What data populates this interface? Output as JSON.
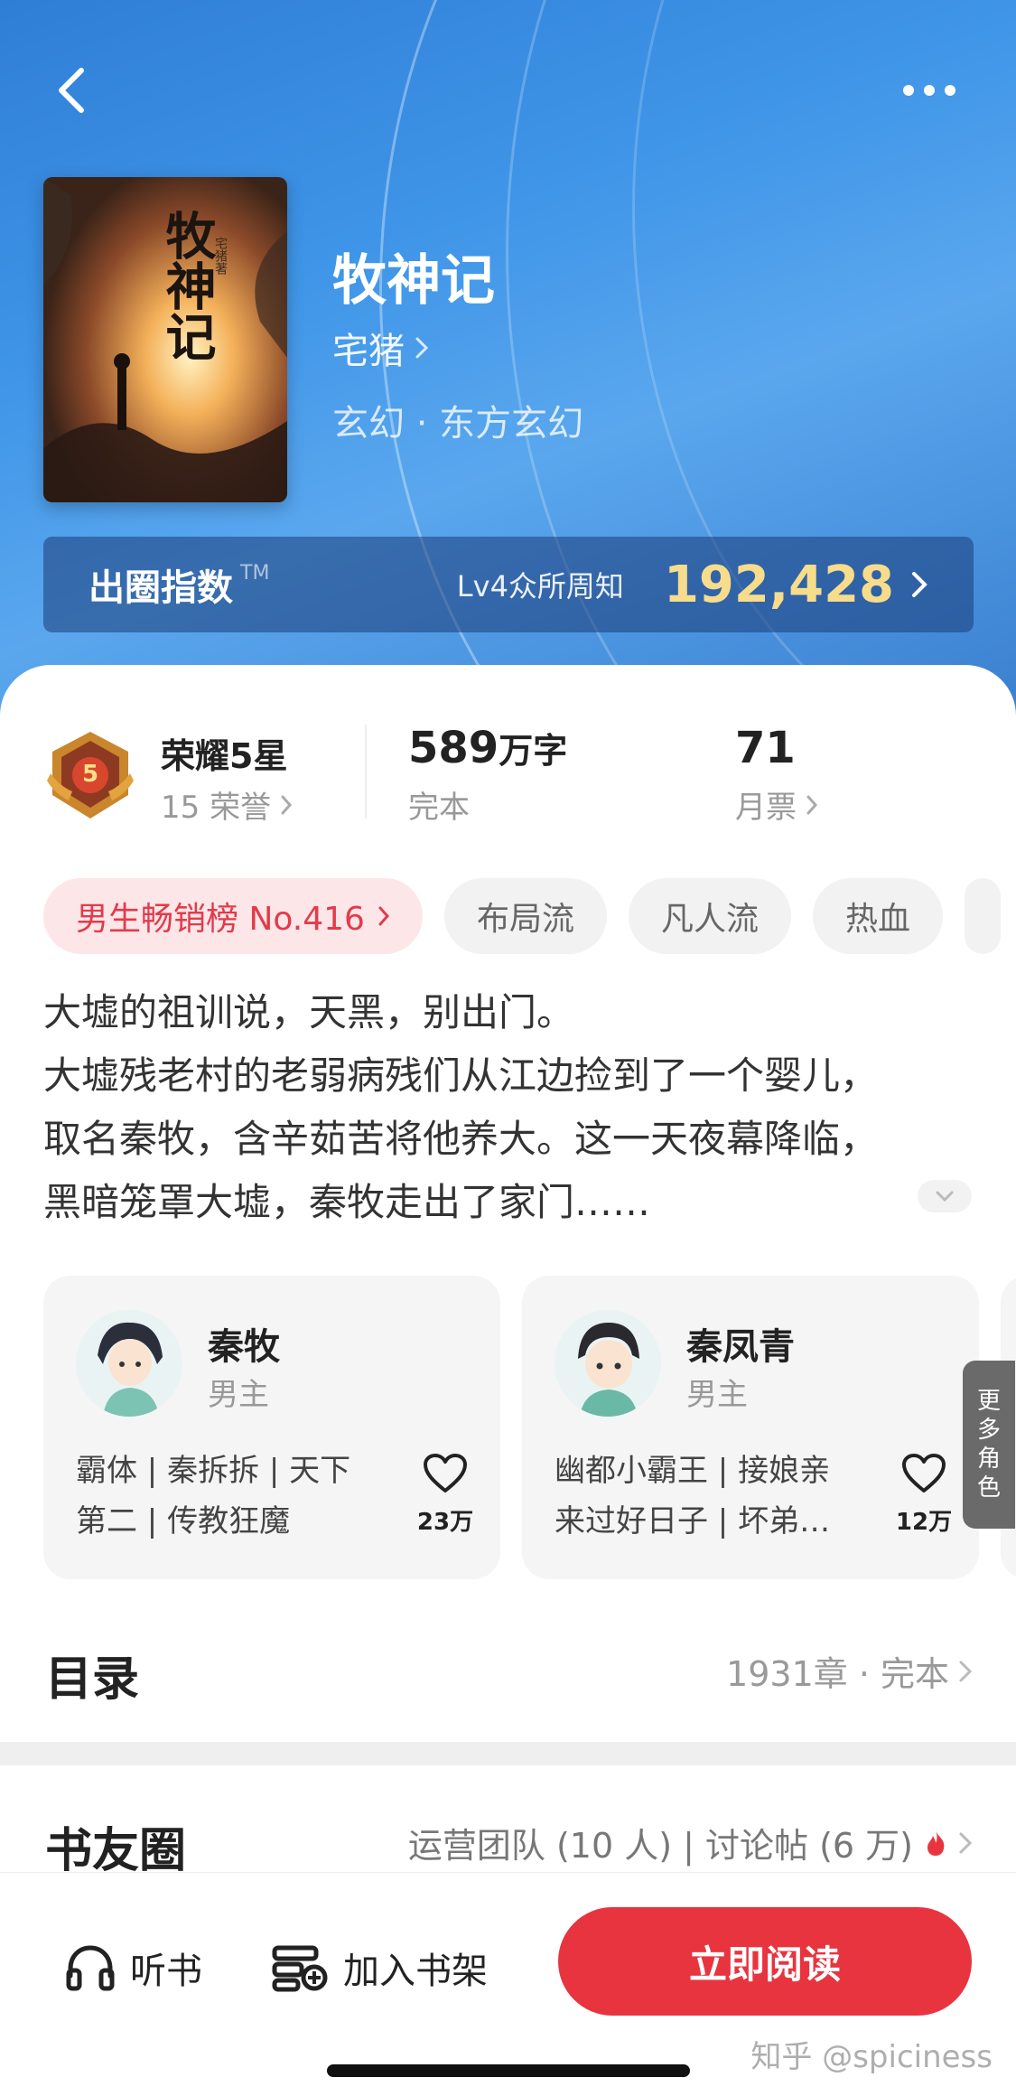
{
  "header": {
    "book_title": "牧神记",
    "author": "宅猪",
    "genre": "玄幻 · 东方玄幻",
    "cover_title": "牧神记",
    "cover_author": "宅猪著"
  },
  "influence_index": {
    "label": "出圈指数",
    "tm": "TM",
    "level": "Lv4众所周知",
    "value": "192,428"
  },
  "stats": {
    "honor_title": "荣耀5星",
    "honor_badge": "5",
    "honor_sub": "15 荣誉",
    "words_value": "589",
    "words_unit": "万字",
    "words_sub": "完本",
    "votes_value": "71",
    "votes_sub": "月票"
  },
  "tags": [
    {
      "label": "男生畅销榜 No.416"
    },
    {
      "label": "布局流"
    },
    {
      "label": "凡人流"
    },
    {
      "label": "热血"
    }
  ],
  "description": {
    "lines": [
      "大墟的祖训说，天黑，别出门。",
      "大墟残老村的老弱病残们从江边捡到了一个婴儿，",
      "取名秦牧，含辛茹苦将他养大。这一天夜幕降临，",
      "黑暗笼罩大墟，秦牧走出了家门……"
    ]
  },
  "characters": [
    {
      "name": "秦牧",
      "role": "男主",
      "traits_line1": "霸体 | 秦拆拆 | 天下",
      "traits_line2": "第二 | 传教狂魔",
      "likes": "23万"
    },
    {
      "name": "秦凤青",
      "role": "男主",
      "traits_line1": "幽都小霸王 | 接娘亲",
      "traits_line2": "来过好日子 | 坏弟…",
      "likes": "12万"
    }
  ],
  "more_roles": [
    "更",
    "多",
    "角",
    "色"
  ],
  "catalog": {
    "title": "目录",
    "meta": "1931章 · 完本"
  },
  "book_circle": {
    "title": "书友圈",
    "meta": "运营团队 (10 人) | 讨论帖 (6 万)"
  },
  "bottom_bar": {
    "listen_label": "听书",
    "shelf_label": "加入书架",
    "read_label": "立即阅读",
    "watermark": "知乎 @spiciness"
  },
  "colors": {
    "hero_blue": "#3f95e8",
    "accent_red": "#e8343f",
    "index_gold": "#f7dc8c",
    "rank_tag_bg": "#fde6e8"
  }
}
